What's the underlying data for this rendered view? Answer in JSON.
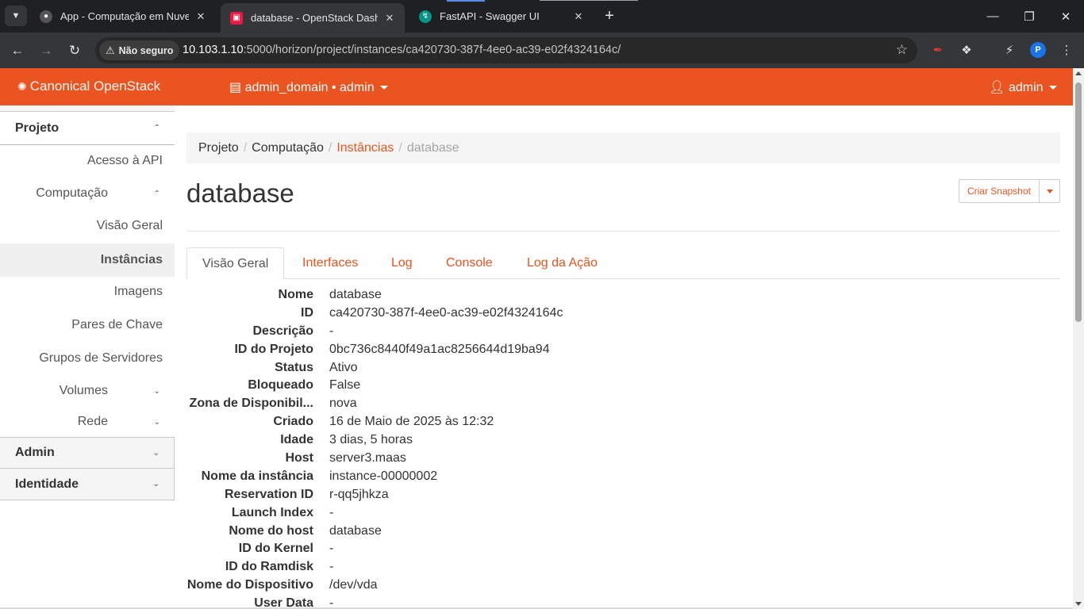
{
  "browser": {
    "tabs": [
      {
        "title": "App - Computação em Nuvem",
        "icon": "github-icon"
      },
      {
        "title": "database - OpenStack Dashboard",
        "icon": "openstack-icon",
        "active": true
      },
      {
        "title": "FastAPI - Swagger UI",
        "icon": "fastapi-icon"
      }
    ],
    "security_label": "Não seguro",
    "url_host": "10.103.1.10",
    "url_path": ":5000/horizon/project/instances/ca420730-387f-4ee0-ac39-e02f4324164c/",
    "profile_initial": "P"
  },
  "header": {
    "brand": "Canonical OpenStack",
    "context": "admin_domain • admin",
    "user": "admin",
    "accent_color": "#e95420"
  },
  "sidebar": {
    "projeto": "Projeto",
    "acesso_api": "Acesso à API",
    "computacao": "Computação",
    "visao_geral": "Visão Geral",
    "instancias": "Instâncias",
    "imagens": "Imagens",
    "pares_chave": "Pares de Chave",
    "grupos_servidores": "Grupos de Servidores",
    "volumes": "Volumes",
    "rede": "Rede",
    "admin": "Admin",
    "identidade": "Identidade"
  },
  "breadcrumb": {
    "projeto": "Projeto",
    "computacao": "Computação",
    "instancias": "Instâncias",
    "current": "database"
  },
  "page": {
    "title": "database",
    "snapshot_button": "Criar Snapshot"
  },
  "tabs": {
    "overview": "Visão Geral",
    "interfaces": "Interfaces",
    "log": "Log",
    "console": "Console",
    "action_log": "Log da Ação"
  },
  "details": [
    {
      "label": "Nome",
      "value": "database"
    },
    {
      "label": "ID",
      "value": "ca420730-387f-4ee0-ac39-e02f4324164c"
    },
    {
      "label": "Descrição",
      "value": "-"
    },
    {
      "label": "ID do Projeto",
      "value": "0bc736c8440f49a1ac8256644d19ba94"
    },
    {
      "label": "Status",
      "value": "Ativo"
    },
    {
      "label": "Bloqueado",
      "value": "False"
    },
    {
      "label": "Zona de Disponibil...",
      "value": "nova"
    },
    {
      "label": "Criado",
      "value": "16 de Maio de 2025 às 12:32"
    },
    {
      "label": "Idade",
      "value": "3 dias, 5 horas"
    },
    {
      "label": "Host",
      "value": "server3.maas"
    },
    {
      "label": "Nome da instância",
      "value": "instance-00000002"
    },
    {
      "label": "Reservation ID",
      "value": "r-qq5jhkza"
    },
    {
      "label": "Launch Index",
      "value": "-"
    },
    {
      "label": "Nome do host",
      "value": "database"
    },
    {
      "label": "ID do Kernel",
      "value": "-"
    },
    {
      "label": "ID do Ramdisk",
      "value": "-"
    },
    {
      "label": "Nome do Dispositivo",
      "value": "/dev/vda"
    },
    {
      "label": "User Data",
      "value": "-"
    }
  ]
}
